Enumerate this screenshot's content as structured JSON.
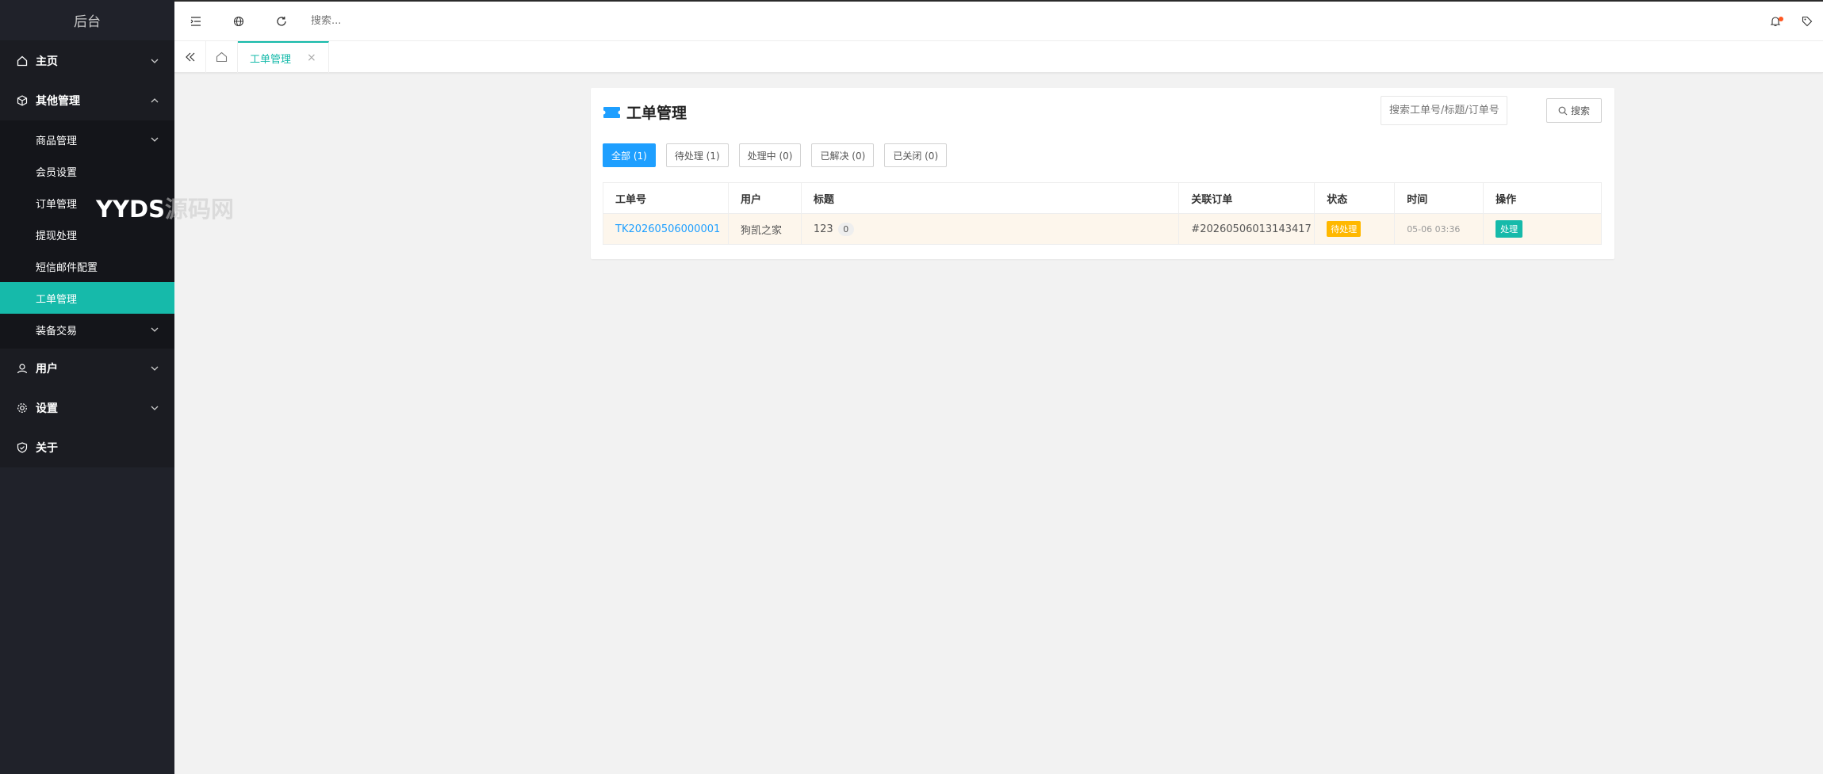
{
  "sidebar": {
    "brand": "后台",
    "items": [
      {
        "label": "主页",
        "icon": "home-icon"
      },
      {
        "label": "其他管理",
        "icon": "cube-icon"
      },
      {
        "label": "用户",
        "icon": "user-icon"
      },
      {
        "label": "设置",
        "icon": "gear-icon"
      },
      {
        "label": "关于",
        "icon": "shield-check-icon"
      }
    ],
    "sub_items": [
      {
        "label": "商品管理"
      },
      {
        "label": "会员设置"
      },
      {
        "label": "订单管理"
      },
      {
        "label": "提现处理"
      },
      {
        "label": "短信邮件配置"
      },
      {
        "label": "工单管理"
      },
      {
        "label": "装备交易"
      }
    ],
    "watermark_a": "YYDS",
    "watermark_b": "源码网"
  },
  "header": {
    "search_placeholder": "搜索..."
  },
  "tabs": [
    {
      "label": "工单管理"
    }
  ],
  "page": {
    "title": "工单管理",
    "search_placeholder": "搜索工单号/标题/订单号",
    "search_button": "搜索",
    "filters": [
      {
        "label": "全部 (1)"
      },
      {
        "label": "待处理 (1)"
      },
      {
        "label": "处理中 (0)"
      },
      {
        "label": "已解决 (0)"
      },
      {
        "label": "已关闭 (0)"
      }
    ],
    "table": {
      "headers": [
        "工单号",
        "用户",
        "标题",
        "关联订单",
        "状态",
        "时间",
        "操作"
      ],
      "rows": [
        {
          "ticket_no": "TK20260506000001",
          "user": "狗凯之家",
          "title": "123",
          "reply_count": "0",
          "order": "#20260506013143417",
          "status": "待处理",
          "time": "05-06 03:36",
          "action": "处理"
        }
      ]
    }
  },
  "colors": {
    "accent": "#16baaa",
    "primary": "#1e9fff",
    "warning": "#ffb800",
    "sidebar_bg": "#20222a"
  }
}
